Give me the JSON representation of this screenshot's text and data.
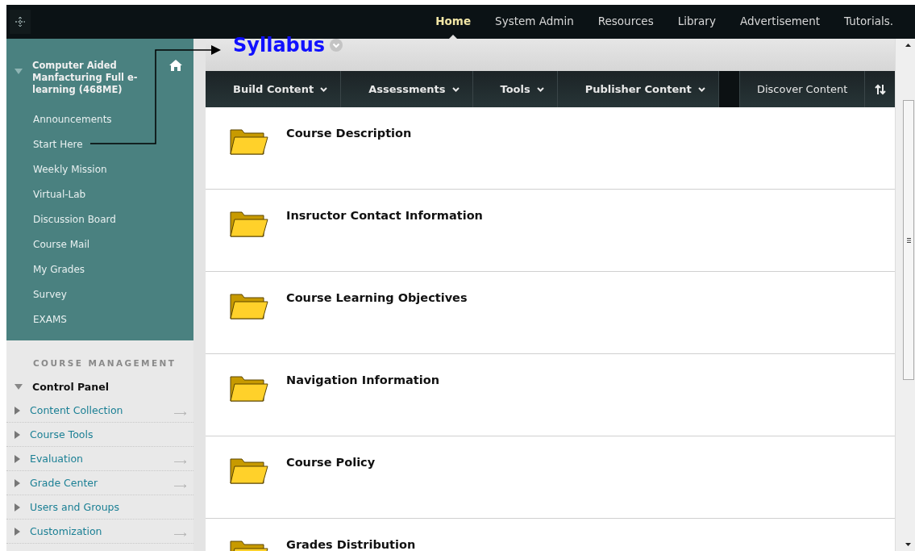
{
  "top_nav": [
    {
      "label": "Home",
      "selected": true
    },
    {
      "label": "System Admin",
      "selected": false
    },
    {
      "label": "Resources",
      "selected": false
    },
    {
      "label": "Library",
      "selected": false
    },
    {
      "label": "Advertisement",
      "selected": false
    },
    {
      "label": "Tutorials.",
      "selected": false
    }
  ],
  "course_menu": {
    "title": "Computer Aided Manfacturing Full e-learning (468ME)",
    "expanded": true,
    "items": [
      "Announcements",
      "Start Here",
      "Weekly Mission",
      "Virtual-Lab",
      "Discussion Board",
      "Course Mail",
      "My Grades",
      "Survey",
      "EXAMS"
    ]
  },
  "course_management": {
    "heading": "COURSE MANAGEMENT",
    "panel": {
      "label": "Control Panel",
      "expanded": true
    },
    "items": [
      {
        "label": "Content Collection",
        "expanded": false,
        "link_arrow": true
      },
      {
        "label": "Course Tools",
        "expanded": false,
        "link_arrow": false
      },
      {
        "label": "Evaluation",
        "expanded": false,
        "link_arrow": true
      },
      {
        "label": "Grade Center",
        "expanded": false,
        "link_arrow": true
      },
      {
        "label": "Users and Groups",
        "expanded": false,
        "link_arrow": false
      },
      {
        "label": "Customization",
        "expanded": false,
        "link_arrow": true
      }
    ]
  },
  "page_title": "Syllabus",
  "toolbar": [
    {
      "label": "Build Content",
      "kind": "menu"
    },
    {
      "label": "Assessments",
      "kind": "menu"
    },
    {
      "label": "Tools",
      "kind": "menu"
    },
    {
      "label": "Publisher Content",
      "kind": "menu"
    },
    {
      "kind": "spacer"
    },
    {
      "label": "Discover Content",
      "kind": "plain"
    },
    {
      "kind": "sort"
    }
  ],
  "content_items": [
    "Course Description",
    "Insructor Contact Information",
    "Course Learning Objectives",
    "Navigation Information",
    "Course Policy",
    "Grades Distribution"
  ]
}
